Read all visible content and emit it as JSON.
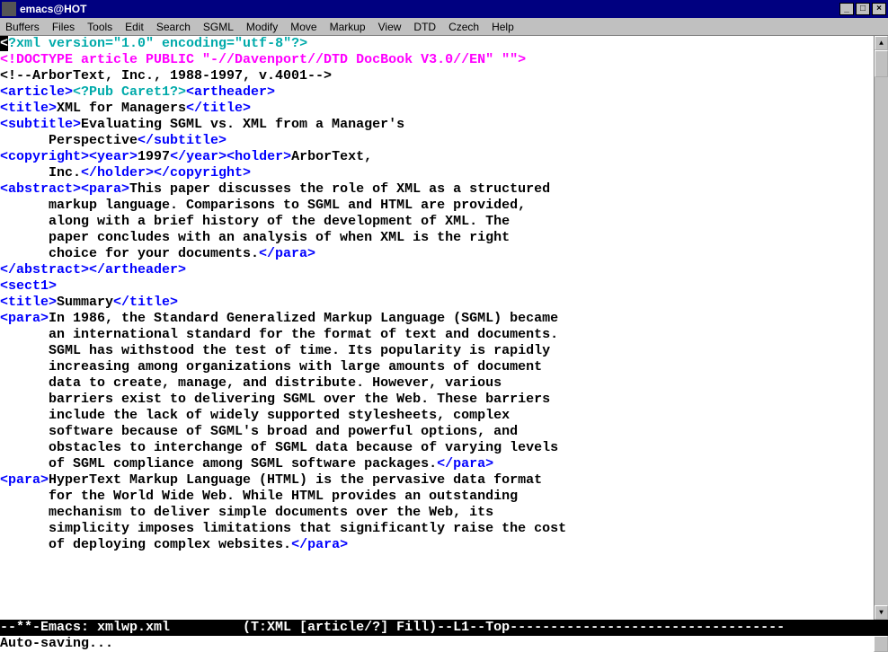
{
  "window": {
    "title": "emacs@HOT"
  },
  "menu": {
    "items": [
      "Buffers",
      "Files",
      "Tools",
      "Edit",
      "Search",
      "SGML",
      "Modify",
      "Move",
      "Markup",
      "View",
      "DTD",
      "Czech",
      "Help"
    ]
  },
  "code": {
    "l0a": "<",
    "l0b": "?xml version=\"1.0\" encoding=\"utf-8\"?>",
    "l1": "<!DOCTYPE article PUBLIC \"-//Davenport//DTD DocBook V3.0//EN\" \"\">",
    "l2": "<!--ArborText, Inc., 1988-1997, v.4001-->",
    "l3_open": "<article>",
    "l3_pi": "<?Pub Caret1?>",
    "l3_close": "<artheader>",
    "l4_open": "<title>",
    "l4_text": "XML for Managers",
    "l4_close": "</title>",
    "l5_open": "<subtitle>",
    "l5_text": "Evaluating SGML vs. XML from a Manager's",
    "l6_text": "      Perspective",
    "l6_close": "</subtitle>",
    "l7_a": "<copyright>",
    "l7_b": "<year>",
    "l7_c": "1997",
    "l7_d": "</year>",
    "l7_e": "<holder>",
    "l7_f": "ArborText,",
    "l8_a": "      Inc.",
    "l8_b": "</holder>",
    "l8_c": "</copyright>",
    "l9_a": "<abstract>",
    "l9_b": "<para>",
    "l9_c": "This paper discusses the role of XML as a structured",
    "l10": "      markup language. Comparisons to SGML and HTML are provided,",
    "l11": "      along with a brief history of the development of XML. The",
    "l12": "      paper concludes with an analysis of when XML is the right",
    "l13_a": "      choice for your documents.",
    "l13_b": "</para>",
    "l14_a": "</abstract>",
    "l14_b": "</artheader>",
    "l15": "<sect1>",
    "l16_a": "<title>",
    "l16_b": "Summary",
    "l16_c": "</title>",
    "l17_a": "<para>",
    "l17_b": "In 1986, the Standard Generalized Markup Language (SGML) became",
    "l18": "      an international standard for the format of text and documents.",
    "l19": "      SGML has withstood the test of time. Its popularity is rapidly",
    "l20": "      increasing among organizations with large amounts of document",
    "l21": "      data to create, manage, and distribute. However, various",
    "l22": "      barriers exist to delivering SGML over the Web. These barriers",
    "l23": "      include the lack of widely supported stylesheets, complex",
    "l24": "      software because of SGML's broad and powerful options, and",
    "l25": "      obstacles to interchange of SGML data because of varying levels",
    "l26_a": "      of SGML compliance among SGML software packages.",
    "l26_b": "</para>",
    "l27_a": "<para>",
    "l27_b": "HyperText Markup Language (HTML) is the pervasive data format",
    "l28": "      for the World Wide Web. While HTML provides an outstanding",
    "l29": "      mechanism to deliver simple documents over the Web, its",
    "l30": "      simplicity imposes limitations that significantly raise the cost",
    "l31_a": "      of deploying complex websites.",
    "l31_b": "</para>"
  },
  "modeline": "--**-Emacs: xmlwp.xml         (T:XML [article/?] Fill)--L1--Top----------------------------------",
  "minibuffer": "Auto-saving..."
}
